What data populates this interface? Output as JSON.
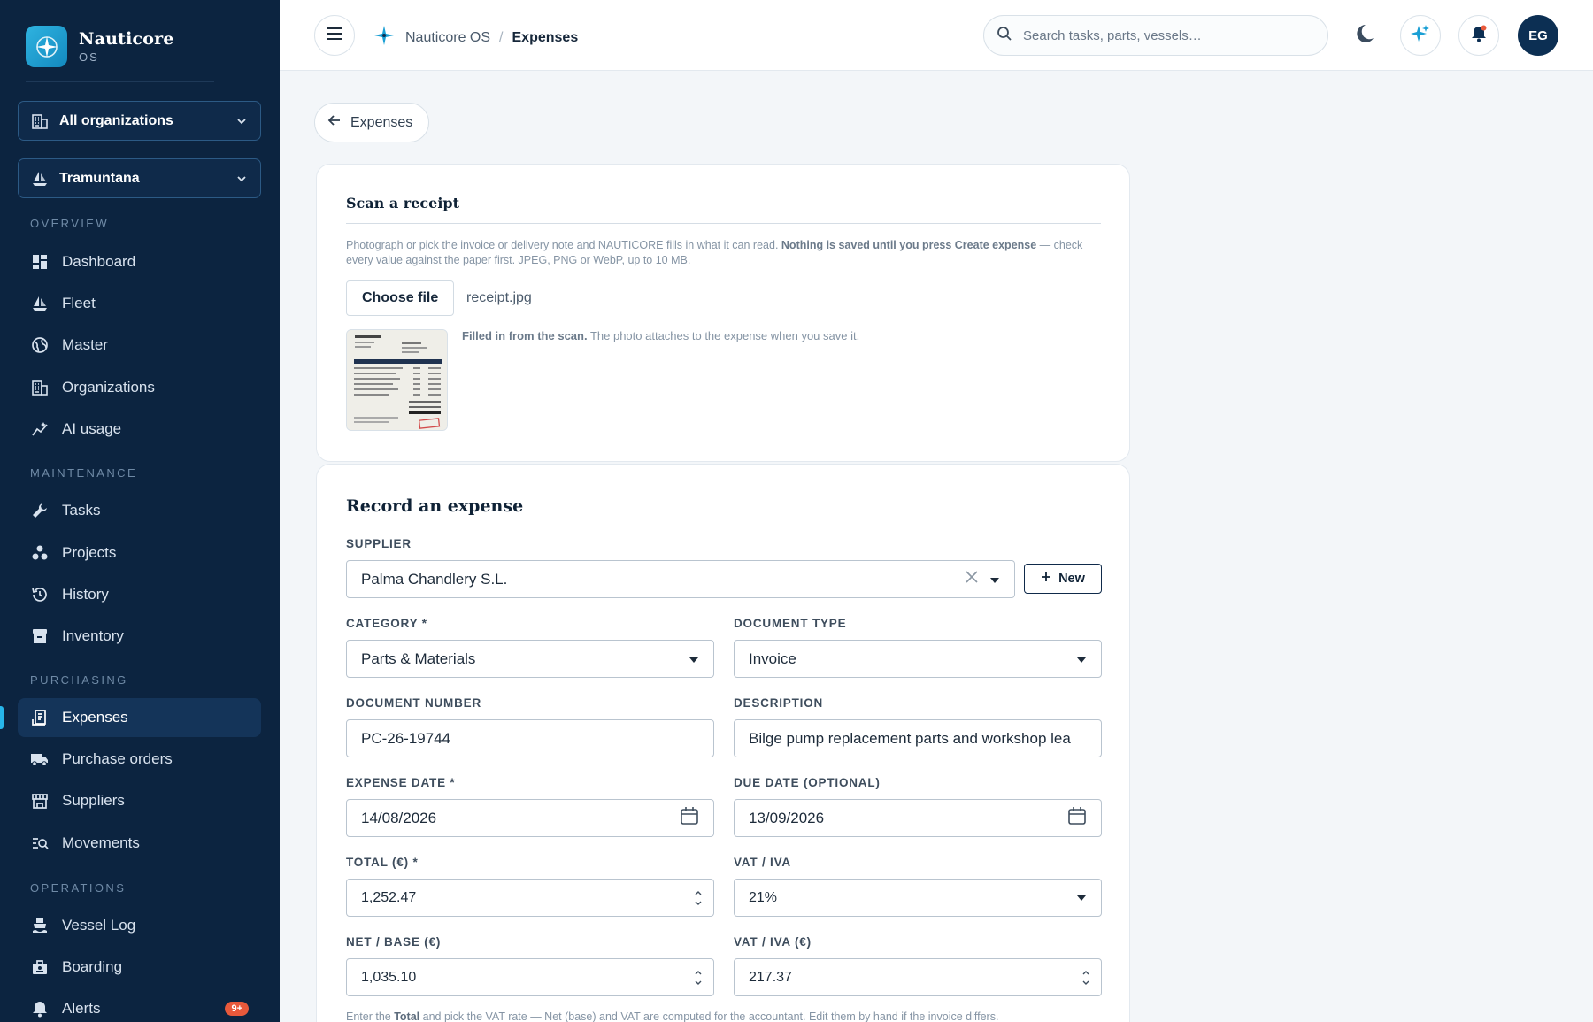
{
  "brand": {
    "name": "Nauticore",
    "sub": "OS"
  },
  "org_selectors": [
    {
      "label": "All organizations"
    },
    {
      "label": "Tramuntana"
    }
  ],
  "sidebar": {
    "sections": {
      "overview": "OVERVIEW",
      "maintenance": "MAINTENANCE",
      "purchasing": "PURCHASING",
      "operations": "OPERATIONS"
    },
    "items": [
      {
        "label": "Dashboard",
        "icon": "dashboard-icon"
      },
      {
        "label": "Fleet",
        "icon": "sailboat-icon"
      },
      {
        "label": "Master",
        "icon": "globe-icon"
      },
      {
        "label": "Organizations",
        "icon": "building-icon"
      },
      {
        "label": "AI usage",
        "icon": "ai-chart-icon"
      },
      {
        "label": "Tasks",
        "icon": "wrench-icon"
      },
      {
        "label": "Projects",
        "icon": "projects-icon"
      },
      {
        "label": "History",
        "icon": "history-icon"
      },
      {
        "label": "Inventory",
        "icon": "archive-icon"
      },
      {
        "label": "Expenses",
        "icon": "receipt-icon",
        "active": true
      },
      {
        "label": "Purchase orders",
        "icon": "truck-icon"
      },
      {
        "label": "Suppliers",
        "icon": "store-icon"
      },
      {
        "label": "Movements",
        "icon": "movements-icon"
      },
      {
        "label": "Vessel Log",
        "icon": "ship-icon"
      },
      {
        "label": "Boarding",
        "icon": "boarding-icon"
      },
      {
        "label": "Alerts",
        "icon": "bell-icon",
        "badge": "9+"
      }
    ]
  },
  "topbar": {
    "breadcrumb_root": "Nauticore OS",
    "breadcrumb_sep": "/",
    "breadcrumb_current": "Expenses",
    "search_placeholder": "Search tasks, parts, vessels…",
    "avatar_initials": "EG"
  },
  "back_button": "Expenses",
  "scan": {
    "title": "Scan a receipt",
    "desc_prefix": "Photograph or pick the invoice or delivery note and NAUTICORE fills in what it can read. ",
    "desc_bold": "Nothing is saved until you press Create expense",
    "desc_suffix": " — check every value against the paper first. JPEG, PNG or WebP, up to 10 MB.",
    "choose_file": "Choose file",
    "file_name": "receipt.jpg",
    "note_bold": "Filled in from the scan.",
    "note_rest": " The photo attaches to the expense when you save it."
  },
  "expense": {
    "title": "Record an expense",
    "supplier_label": "SUPPLIER",
    "supplier_value": "Palma Chandlery S.L.",
    "new_button": "New",
    "category_label": "CATEGORY *",
    "category_value": "Parts & Materials",
    "doctype_label": "DOCUMENT TYPE",
    "doctype_value": "Invoice",
    "docnum_label": "DOCUMENT NUMBER",
    "docnum_value": "PC-26-19744",
    "description_label": "DESCRIPTION",
    "description_value": "Bilge pump replacement parts and workshop lea",
    "expense_date_label": "EXPENSE DATE *",
    "expense_date_value": "14/08/2026",
    "due_date_label": "DUE DATE (OPTIONAL)",
    "due_date_value": "13/09/2026",
    "total_label": "TOTAL (€) *",
    "total_value": "1,252.47",
    "vat_rate_label": "VAT / IVA",
    "vat_rate_value": "21%",
    "net_label": "NET / BASE (€)",
    "net_value": "1,035.10",
    "vat_amount_label": "VAT / IVA (€)",
    "vat_amount_value": "217.37",
    "help_prefix": "Enter the ",
    "help_bold": "Total",
    "help_rest": " and pick the VAT rate — Net (base) and VAT are computed for the accountant. Edit them by hand if the invoice differs."
  },
  "colors": {
    "sidebar_bg": "#0c2440",
    "accent": "#27b6ea",
    "badge": "#e8593b"
  }
}
